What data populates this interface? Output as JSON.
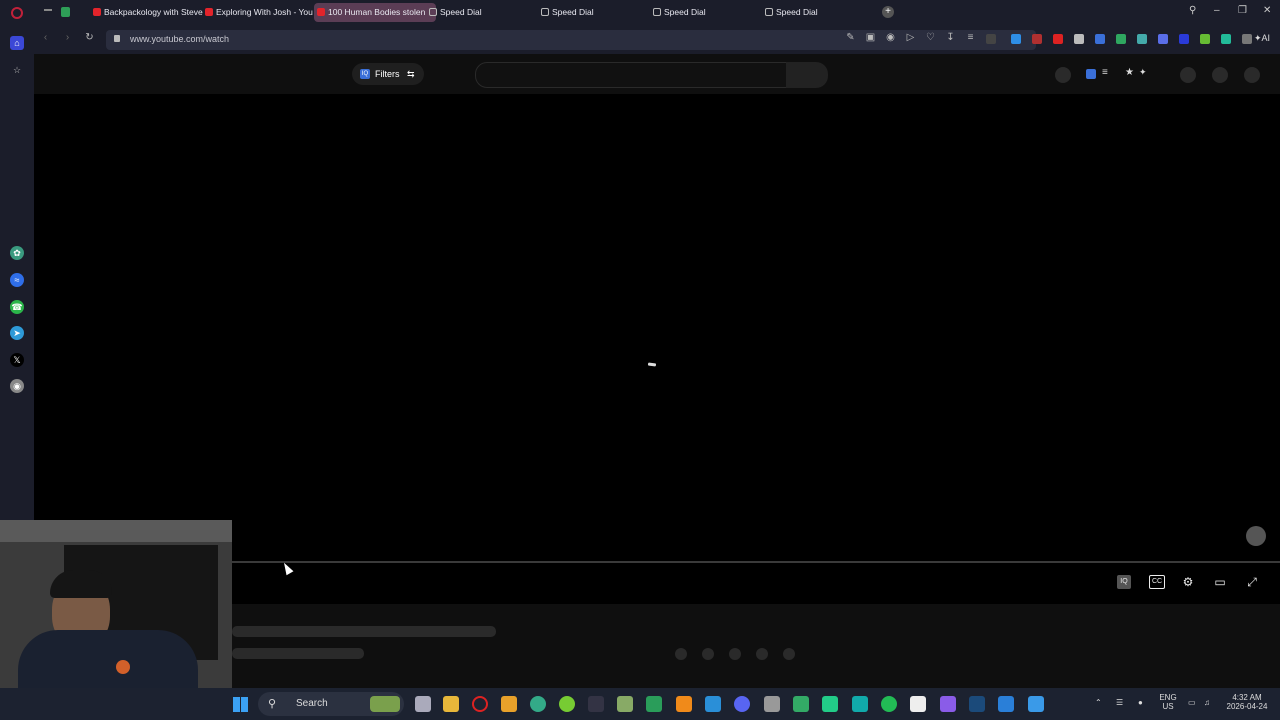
{
  "tabs": [
    {
      "label": "Backpackology with Steve",
      "icon": "youtube-icon"
    },
    {
      "label": "Exploring With Josh - You",
      "icon": "youtube-icon"
    },
    {
      "label": "100 Human Bodies stolen",
      "icon": "youtube-icon",
      "active": true
    },
    {
      "label": "Speed Dial",
      "icon": "speed-dial-icon"
    },
    {
      "label": "Speed Dial",
      "icon": "speed-dial-icon"
    },
    {
      "label": "Speed Dial",
      "icon": "speed-dial-icon"
    },
    {
      "label": "Speed Dial",
      "icon": "speed-dial-icon"
    }
  ],
  "address": {
    "url": "www.youtube.com/watch"
  },
  "toolbar": {
    "ai_label": "AI"
  },
  "youtube": {
    "filters_label": "Filters",
    "iq_label": "IQ"
  },
  "player": {
    "iq_label": "IQ",
    "cc_label": "CC"
  },
  "taskbar": {
    "search_label": "Search",
    "lang_line1": "ENG",
    "lang_line2": "US",
    "time": "4:32 AM",
    "date": "2026-04-24"
  },
  "colors": {
    "accent": "#5b3d55",
    "youtube_red": "#e3242b",
    "browser_bg": "#1b1d2a"
  }
}
